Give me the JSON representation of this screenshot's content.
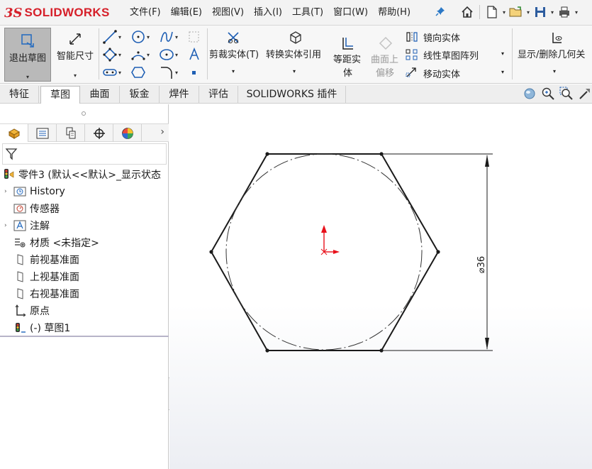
{
  "app": {
    "brand": "SOLIDWORKS",
    "brand_prefix": "3S"
  },
  "menu": [
    "文件(F)",
    "编辑(E)",
    "视图(V)",
    "插入(I)",
    "工具(T)",
    "窗口(W)",
    "帮助(H)"
  ],
  "ribbon": {
    "exit_sketch": "退出草图",
    "smart_dimension": "智能尺寸",
    "trim": "剪裁实体(T)",
    "convert": "转换实体引用",
    "offset_line1": "等距实",
    "offset_line2": "体",
    "surface_offset_line1": "曲面上",
    "surface_offset_line2": "偏移",
    "mirror": "镜向实体",
    "linear_pattern": "线性草图阵列",
    "move": "移动实体",
    "display_relations": "显示/删除几何关"
  },
  "tabs": [
    "特征",
    "草图",
    "曲面",
    "钣金",
    "焊件",
    "评估",
    "SOLIDWORKS 插件"
  ],
  "active_tab": "草图",
  "tree": {
    "root": "零件3  (默认<<默认>_显示状态",
    "history": "History",
    "sensors": "传感器",
    "annotations": "注解",
    "material": "材质 <未指定>",
    "front_plane": "前视基准面",
    "top_plane": "上视基准面",
    "right_plane": "右视基准面",
    "origin": "原点",
    "sketch": "(-) 草图1"
  },
  "dimension_label": "⌀36",
  "colors": {
    "brand_red": "#d6202a",
    "origin_red": "#e8101a",
    "active_tab_bg": "#ffffff",
    "exit_sketch_bg": "#b9b9b9"
  }
}
